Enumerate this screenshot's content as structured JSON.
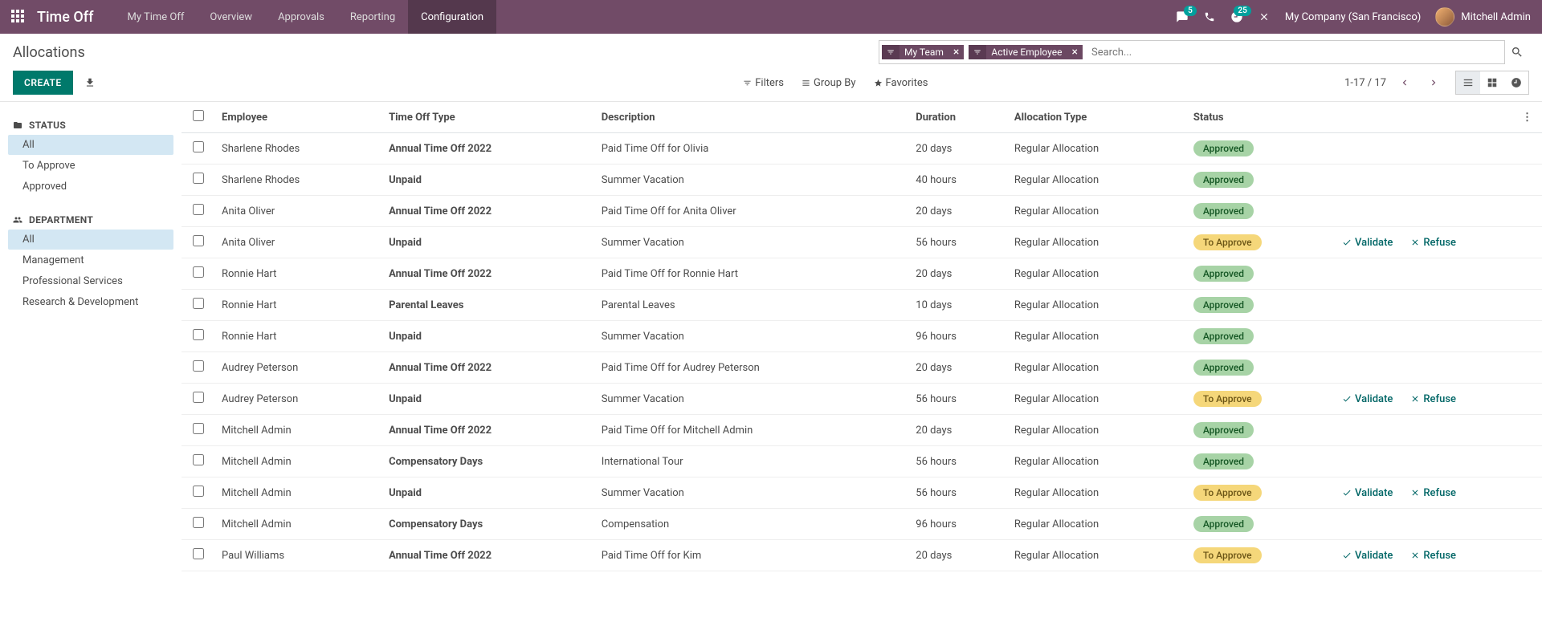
{
  "header": {
    "app_title": "Time Off",
    "menu": [
      "My Time Off",
      "Overview",
      "Approvals",
      "Reporting",
      "Configuration"
    ],
    "active_menu_index": 4,
    "msg_count": "5",
    "activity_count": "25",
    "company": "My Company (San Francisco)",
    "user": "Mitchell Admin"
  },
  "control": {
    "title": "Allocations",
    "create": "CREATE",
    "facets": [
      {
        "label": "My Team"
      },
      {
        "label": "Active Employee"
      }
    ],
    "search_placeholder": "Search...",
    "filters": "Filters",
    "groupby": "Group By",
    "favorites": "Favorites",
    "pager": "1-17 / 17"
  },
  "sidebar": {
    "status": {
      "header": "STATUS",
      "items": [
        "All",
        "To Approve",
        "Approved"
      ],
      "selected": 0
    },
    "department": {
      "header": "DEPARTMENT",
      "items": [
        "All",
        "Management",
        "Professional Services",
        "Research & Development"
      ],
      "selected": 0
    }
  },
  "table": {
    "headers": [
      "Employee",
      "Time Off Type",
      "Description",
      "Duration",
      "Allocation Type",
      "Status"
    ],
    "actions": {
      "validate": "Validate",
      "refuse": "Refuse"
    },
    "rows": [
      {
        "employee": "Sharlene Rhodes",
        "type": "Annual Time Off 2022",
        "desc": "Paid Time Off for Olivia",
        "duration": "20 days",
        "alloc": "Regular Allocation",
        "status": "Approved",
        "showActions": false
      },
      {
        "employee": "Sharlene Rhodes",
        "type": "Unpaid",
        "desc": "Summer Vacation",
        "duration": "40 hours",
        "alloc": "Regular Allocation",
        "status": "Approved",
        "showActions": false
      },
      {
        "employee": "Anita Oliver",
        "type": "Annual Time Off 2022",
        "desc": "Paid Time Off for Anita Oliver",
        "duration": "20 days",
        "alloc": "Regular Allocation",
        "status": "Approved",
        "showActions": false
      },
      {
        "employee": "Anita Oliver",
        "type": "Unpaid",
        "desc": "Summer Vacation",
        "duration": "56 hours",
        "alloc": "Regular Allocation",
        "status": "To Approve",
        "showActions": true
      },
      {
        "employee": "Ronnie Hart",
        "type": "Annual Time Off 2022",
        "desc": "Paid Time Off for Ronnie Hart",
        "duration": "20 days",
        "alloc": "Regular Allocation",
        "status": "Approved",
        "showActions": false
      },
      {
        "employee": "Ronnie Hart",
        "type": "Parental Leaves",
        "desc": "Parental Leaves",
        "duration": "10 days",
        "alloc": "Regular Allocation",
        "status": "Approved",
        "showActions": false
      },
      {
        "employee": "Ronnie Hart",
        "type": "Unpaid",
        "desc": "Summer Vacation",
        "duration": "96 hours",
        "alloc": "Regular Allocation",
        "status": "Approved",
        "showActions": false
      },
      {
        "employee": "Audrey Peterson",
        "type": "Annual Time Off 2022",
        "desc": "Paid Time Off for Audrey Peterson",
        "duration": "20 days",
        "alloc": "Regular Allocation",
        "status": "Approved",
        "showActions": false
      },
      {
        "employee": "Audrey Peterson",
        "type": "Unpaid",
        "desc": "Summer Vacation",
        "duration": "56 hours",
        "alloc": "Regular Allocation",
        "status": "To Approve",
        "showActions": true
      },
      {
        "employee": "Mitchell Admin",
        "type": "Annual Time Off 2022",
        "desc": "Paid Time Off for Mitchell Admin",
        "duration": "20 days",
        "alloc": "Regular Allocation",
        "status": "Approved",
        "showActions": false
      },
      {
        "employee": "Mitchell Admin",
        "type": "Compensatory Days",
        "desc": "International Tour",
        "duration": "56 hours",
        "alloc": "Regular Allocation",
        "status": "Approved",
        "showActions": false
      },
      {
        "employee": "Mitchell Admin",
        "type": "Unpaid",
        "desc": "Summer Vacation",
        "duration": "56 hours",
        "alloc": "Regular Allocation",
        "status": "To Approve",
        "showActions": true
      },
      {
        "employee": "Mitchell Admin",
        "type": "Compensatory Days",
        "desc": "Compensation",
        "duration": "96 hours",
        "alloc": "Regular Allocation",
        "status": "Approved",
        "showActions": false
      },
      {
        "employee": "Paul Williams",
        "type": "Annual Time Off 2022",
        "desc": "Paid Time Off for Kim",
        "duration": "20 days",
        "alloc": "Regular Allocation",
        "status": "To Approve",
        "showActions": true
      }
    ]
  }
}
